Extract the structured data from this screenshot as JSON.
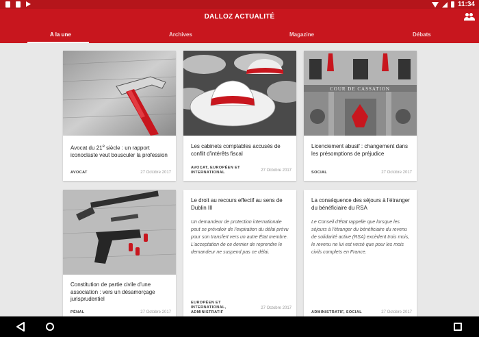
{
  "status_bar": {
    "time": "11:34",
    "icons": [
      "notification-icon",
      "sim-icon",
      "play-store-icon",
      "wifi-icon",
      "signal-icon",
      "battery-icon"
    ]
  },
  "app": {
    "title": "DALLOZ ACTUALITÉ",
    "accent_color": "#c8161e",
    "tabs": [
      {
        "label": "A la une",
        "active": true
      },
      {
        "label": "Archives",
        "active": false
      },
      {
        "label": "Magazine",
        "active": false
      },
      {
        "label": "Débats",
        "active": false
      }
    ]
  },
  "cards": [
    {
      "title_before": "Avocat du 21",
      "title_sup": "e",
      "title_after": " siècle : un rapport iconoclaste veut bousculer la profession",
      "tag": "AVOCAT",
      "date": "27 Octobre 2017",
      "image": "hammer"
    },
    {
      "title": "Les cabinets comptables accusés de conflit d'intérêts fiscal",
      "tag": "AVOCAT, EUROPÉEN ET INTERNATIONAL",
      "date": "27 Octobre 2017",
      "image": "hats"
    },
    {
      "title": "Licenciement abusif : changement dans les présomptions de préjudice",
      "tag": "SOCIAL",
      "date": "27 Octobre 2017",
      "image": "cour-de-cassation"
    },
    {
      "title": "Constitution de partie civile d'une association : vers un désamorçage jurisprudentiel",
      "tag": "PÉNAL",
      "date": "27 Octobre 2017",
      "image": "gun"
    },
    {
      "title": "Le droit au recours effectif au sens de Dublin III",
      "excerpt": "Un demandeur de protection internationale peut se prévaloir de l'expiration du délai prévu pour son transfert vers un autre État membre. L'acceptation de ce dernier de reprendre le demandeur ne suspend pas ce délai.",
      "tag": "EUROPÉEN ET INTERNATIONAL, ADMINISTRATIF",
      "date": "27 Octobre 2017"
    },
    {
      "title": "La conséquence des séjours à l'étranger du bénéficiaire du RSA",
      "excerpt": "Le Conseil d'État rappelle que lorsque les séjours à l'étranger du bénéficiaire du revenu de solidarité active (RSA) excèdent trois mois, le revenu ne lui est versé que pour les mois civils complets en France.",
      "tag": "ADMINISTRATIF, SOCIAL",
      "date": "27 Octobre 2017"
    }
  ],
  "building_inscription": "COUR DE CASSATION"
}
